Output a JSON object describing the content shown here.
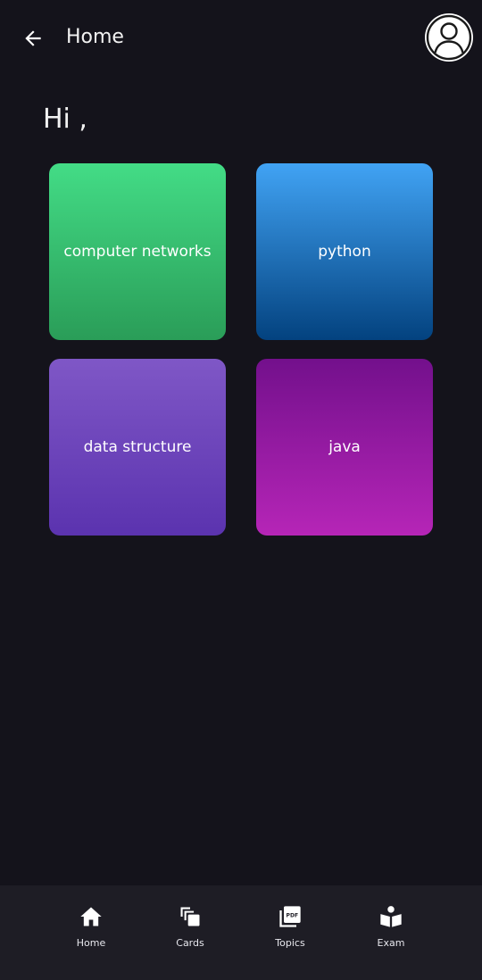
{
  "header": {
    "title": "Home",
    "back_icon": "arrow-left-icon",
    "avatar_icon": "account-circle-icon"
  },
  "greeting": "Hi ,",
  "topics": [
    {
      "label": "computer networks",
      "gradient": [
        "#43dc86",
        "#2a9d58"
      ]
    },
    {
      "label": "python",
      "gradient": [
        "#41a3f4",
        "#03427f"
      ]
    },
    {
      "label": "data structure",
      "gradient": [
        "#7f57c6",
        "#5b33af"
      ]
    },
    {
      "label": "java",
      "gradient": [
        "#73108c",
        "#b625b7"
      ]
    }
  ],
  "bottom_nav": {
    "items": [
      {
        "label": "Home",
        "icon": "home-icon"
      },
      {
        "label": "Cards",
        "icon": "cards-icon"
      },
      {
        "label": "Topics",
        "icon": "pdf-icon"
      },
      {
        "label": "Exam",
        "icon": "book-reader-icon"
      }
    ]
  }
}
